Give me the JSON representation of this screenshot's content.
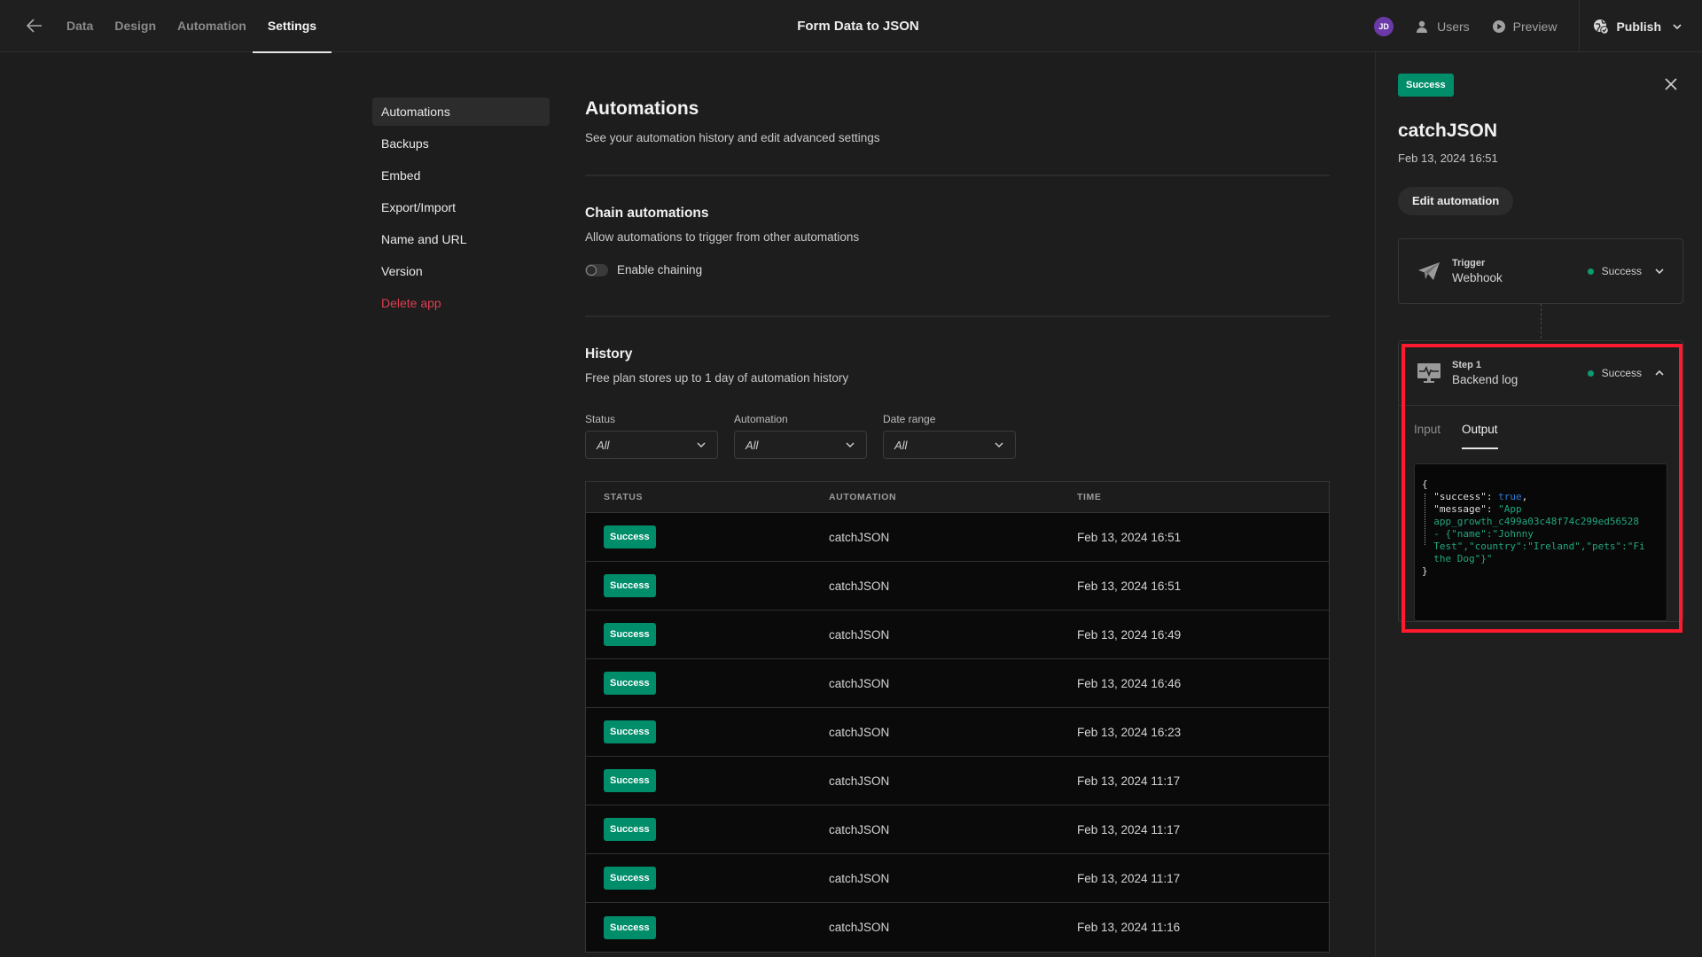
{
  "topbar": {
    "nav": [
      {
        "label": "Data",
        "active": false
      },
      {
        "label": "Design",
        "active": false
      },
      {
        "label": "Automation",
        "active": false
      },
      {
        "label": "Settings",
        "active": true
      }
    ],
    "app_title": "Form Data to JSON",
    "avatar_initials": "JD",
    "users_label": "Users",
    "preview_label": "Preview",
    "publish_label": "Publish"
  },
  "sidebar": {
    "items": [
      {
        "label": "Automations",
        "active": true
      },
      {
        "label": "Backups"
      },
      {
        "label": "Embed"
      },
      {
        "label": "Export/Import"
      },
      {
        "label": "Name and URL"
      },
      {
        "label": "Version"
      },
      {
        "label": "Delete app",
        "danger": true
      }
    ]
  },
  "main": {
    "title": "Automations",
    "subtitle": "See your automation history and edit advanced settings",
    "chain": {
      "title": "Chain automations",
      "description": "Allow automations to trigger from other automations",
      "toggle_label": "Enable chaining",
      "enabled": false
    },
    "history": {
      "title": "History",
      "description": "Free plan stores up to 1 day of automation history",
      "filters": [
        {
          "label": "Status",
          "value": "All"
        },
        {
          "label": "Automation",
          "value": "All"
        },
        {
          "label": "Date range",
          "value": "All"
        }
      ],
      "columns": [
        "STATUS",
        "AUTOMATION",
        "TIME"
      ],
      "rows": [
        {
          "status": "Success",
          "automation": "catchJSON",
          "time": "Feb 13, 2024 16:51"
        },
        {
          "status": "Success",
          "automation": "catchJSON",
          "time": "Feb 13, 2024 16:51"
        },
        {
          "status": "Success",
          "automation": "catchJSON",
          "time": "Feb 13, 2024 16:49"
        },
        {
          "status": "Success",
          "automation": "catchJSON",
          "time": "Feb 13, 2024 16:46"
        },
        {
          "status": "Success",
          "automation": "catchJSON",
          "time": "Feb 13, 2024 16:23"
        },
        {
          "status": "Success",
          "automation": "catchJSON",
          "time": "Feb 13, 2024 11:17"
        },
        {
          "status": "Success",
          "automation": "catchJSON",
          "time": "Feb 13, 2024 11:17"
        },
        {
          "status": "Success",
          "automation": "catchJSON",
          "time": "Feb 13, 2024 11:17"
        },
        {
          "status": "Success",
          "automation": "catchJSON",
          "time": "Feb 13, 2024 11:16"
        }
      ]
    }
  },
  "panel": {
    "status": "Success",
    "title": "catchJSON",
    "date": "Feb 13, 2024 16:51",
    "edit_label": "Edit automation",
    "trigger": {
      "kind": "Trigger",
      "name": "Webhook",
      "status": "Success",
      "icon": "paper-plane-icon"
    },
    "step": {
      "kind": "Step 1",
      "name": "Backend log",
      "status": "Success",
      "icon": "monitor-pulse-icon",
      "tabs": [
        "Input",
        "Output"
      ],
      "active_tab": "Output",
      "output": {
        "open": "{",
        "success_key": "\"success\": ",
        "success_val": "true",
        "message_key": "\"message\": ",
        "message_lines": [
          "\"App",
          "app_growth_c499a03c48f74c299ed56528",
          "- {\"name\":\"Johnny",
          "Test\",\"country\":\"Ireland\",\"pets\":\"Fi",
          "the Dog\"}\""
        ],
        "close": "}"
      }
    }
  },
  "colors": {
    "success": "#008d6a",
    "danger": "#dd3e52",
    "highlight": "#ff1a2e",
    "avatar": "#6b3aa8"
  }
}
